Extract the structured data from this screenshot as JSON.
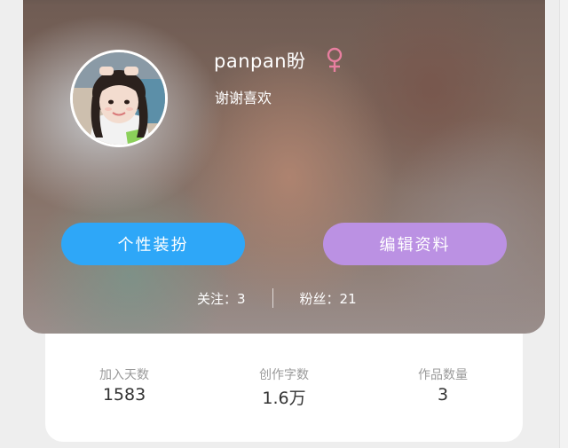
{
  "profile": {
    "username": "panpan盼",
    "gender_icon": "female-symbol-icon",
    "bio": "谢谢喜欢",
    "avatar": "avatar-photo"
  },
  "buttons": {
    "personalize": "个性装扮",
    "edit_profile": "编辑资料"
  },
  "follow": {
    "following": "关注：3",
    "fans": "粉丝：21"
  },
  "stats": [
    {
      "label": "加入天数",
      "value": "1583"
    },
    {
      "label": "创作字数",
      "value": "1.6万"
    },
    {
      "label": "作品数量",
      "value": "3"
    }
  ],
  "colors": {
    "personalize_button": "#2ea7f8",
    "edit_button": "#bb91e3",
    "gender_icon": "#e87fa0"
  }
}
